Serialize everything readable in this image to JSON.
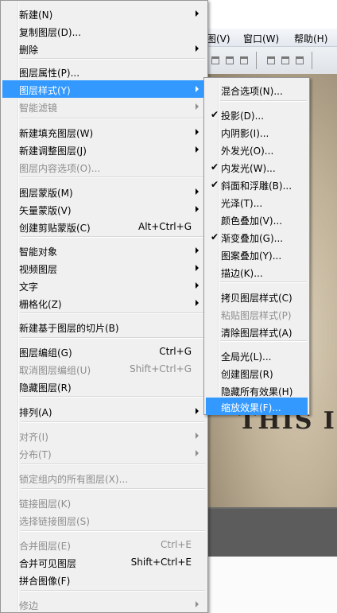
{
  "app": {
    "menubar": [
      "图(V)",
      "窗口(W)",
      "帮助(H)"
    ],
    "canvas_text": "THIS IS"
  },
  "layer_menu": {
    "items": [
      {
        "label": "新建(N)",
        "submenu": true
      },
      {
        "label": "复制图层(D)..."
      },
      {
        "label": "删除",
        "submenu": true
      },
      {
        "label": "图层属性(P)..."
      },
      {
        "label": "图层样式(Y)",
        "submenu": true,
        "highlighted": true
      },
      {
        "label": "智能滤镜",
        "submenu": true,
        "disabled": true
      },
      {
        "label": "新建填充图层(W)",
        "submenu": true
      },
      {
        "label": "新建调整图层(J)",
        "submenu": true
      },
      {
        "label": "图层内容选项(O)...",
        "disabled": true
      },
      {
        "label": "图层蒙版(M)",
        "submenu": true
      },
      {
        "label": "矢量蒙版(V)",
        "submenu": true
      },
      {
        "label": "创建剪贴蒙版(C)",
        "shortcut": "Alt+Ctrl+G"
      },
      {
        "label": "智能对象",
        "submenu": true
      },
      {
        "label": "视频图层",
        "submenu": true
      },
      {
        "label": "文字",
        "submenu": true
      },
      {
        "label": "栅格化(Z)",
        "submenu": true
      },
      {
        "label": "新建基于图层的切片(B)"
      },
      {
        "label": "图层编组(G)",
        "shortcut": "Ctrl+G"
      },
      {
        "label": "取消图层编组(U)",
        "shortcut": "Shift+Ctrl+G",
        "disabled": true
      },
      {
        "label": "隐藏图层(R)"
      },
      {
        "label": "排列(A)",
        "submenu": true
      },
      {
        "label": "对齐(I)",
        "submenu": true,
        "disabled": true
      },
      {
        "label": "分布(T)",
        "submenu": true,
        "disabled": true
      },
      {
        "label": "锁定组内的所有图层(X)...",
        "disabled": true
      },
      {
        "label": "链接图层(K)",
        "disabled": true
      },
      {
        "label": "选择链接图层(S)",
        "disabled": true
      },
      {
        "label": "合并图层(E)",
        "shortcut": "Ctrl+E",
        "disabled": true
      },
      {
        "label": "合并可见图层",
        "shortcut": "Shift+Ctrl+E"
      },
      {
        "label": "拼合图像(F)"
      },
      {
        "label": "修边",
        "submenu": true,
        "disabled": true
      }
    ]
  },
  "style_menu": {
    "items": [
      {
        "label": "混合选项(N)..."
      },
      {
        "label": "投影(D)...",
        "checked": true
      },
      {
        "label": "内阴影(I)..."
      },
      {
        "label": "外发光(O)..."
      },
      {
        "label": "内发光(W)...",
        "checked": true
      },
      {
        "label": "斜面和浮雕(B)...",
        "checked": true
      },
      {
        "label": "光泽(T)..."
      },
      {
        "label": "颜色叠加(V)..."
      },
      {
        "label": "渐变叠加(G)...",
        "checked": true
      },
      {
        "label": "图案叠加(Y)..."
      },
      {
        "label": "描边(K)..."
      },
      {
        "label": "拷贝图层样式(C)"
      },
      {
        "label": "粘贴图层样式(P)",
        "disabled": true
      },
      {
        "label": "清除图层样式(A)"
      },
      {
        "label": "全局光(L)..."
      },
      {
        "label": "创建图层(R)"
      },
      {
        "label": "隐藏所有效果(H)"
      },
      {
        "label": "缩放效果(F)...",
        "highlighted": true
      }
    ]
  },
  "check_glyph": "✔",
  "colors": {
    "highlight": "#3399ff",
    "menu_bg": "#f0f0f0",
    "disabled": "#8d8d8d"
  }
}
